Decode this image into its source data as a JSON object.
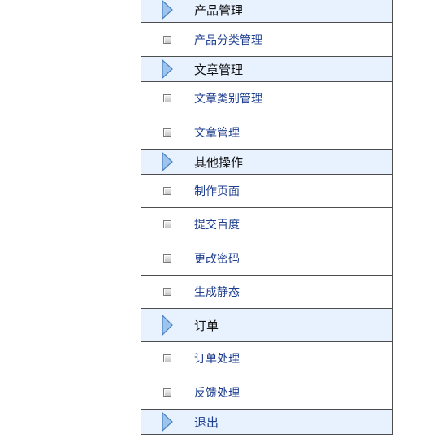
{
  "menu": {
    "sections": [
      {
        "title": "产品管理",
        "items": [
          "产品分类管理"
        ]
      },
      {
        "title": "文章管理",
        "items": [
          "文章类别管理",
          "文章管理"
        ]
      },
      {
        "title": "其他操作",
        "items": [
          "制作页面",
          "提交百度",
          "更改密码",
          "生成静态"
        ]
      },
      {
        "title": "订单",
        "items": [
          "订单处理",
          "反馈处理"
        ]
      },
      {
        "title": "退出",
        "items": []
      }
    ]
  },
  "colors": {
    "header_background": "#e8f2fe",
    "link_text": "#1d3e8e",
    "border": "#4d4d4d",
    "arrow_fill": "#9cc4ec",
    "arrow_stroke": "#4a7fc0"
  },
  "icons": {
    "section": "right-arrow-icon",
    "item": "square-bullet-icon"
  }
}
